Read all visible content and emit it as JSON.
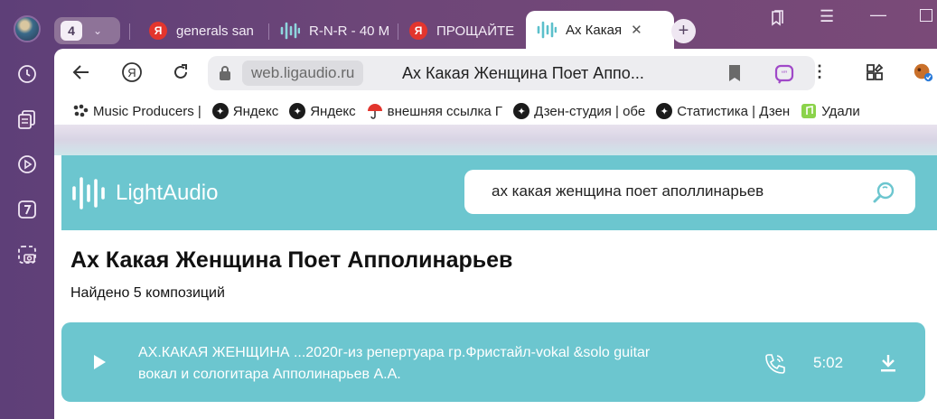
{
  "tab_strip": {
    "tab_count": "4",
    "tabs": [
      {
        "favicon": "yandex-icon",
        "title": "generals san"
      },
      {
        "favicon": "ligaudio-wave-icon",
        "title": "R-N-R - 40 M"
      },
      {
        "favicon": "yandex-icon",
        "title": "ПРОЩАЙТЕ"
      },
      {
        "favicon": "ligaudio-wave-icon",
        "title": "Ах Какая",
        "active": true
      }
    ],
    "yandex_letter": "Я"
  },
  "toolbar": {
    "domain": "web.ligaudio.ru",
    "page_title": "Ах Какая Женщина Поет Аппо..."
  },
  "bookmarks": [
    {
      "icon": "music-producers-icon",
      "label": "Music Producers |"
    },
    {
      "icon": "yandex-star-icon",
      "label": "Яндекс"
    },
    {
      "icon": "yandex-star-icon",
      "label": "Яндекс"
    },
    {
      "icon": "umbrella-icon",
      "label": "внешняя ссылка Г"
    },
    {
      "icon": "yandex-star-icon",
      "label": "Дзен-студия | обе"
    },
    {
      "icon": "yandex-star-icon",
      "label": "Статистика | Дзен"
    },
    {
      "icon": "green-note-icon",
      "label": "Удали"
    }
  ],
  "site": {
    "brand": "LightAudio",
    "search_query": "ах какая женщина поет аполлинарьев",
    "heading": "Ах Какая Женщина Поет Апполинарьев",
    "found_text": "Найдено 5 композиций",
    "tracks": [
      {
        "title_line1": "АХ.КАКАЯ ЖЕНЩИНА ...2020г-из репертуара гр.Фристайл-vokal &solo guitar",
        "title_line2": "вокал и сологитара Апполинарьев А.А.",
        "duration": "5:02"
      }
    ]
  },
  "colors": {
    "accent": "#6cc6cf",
    "sidebar_bg": "#6d4678"
  }
}
